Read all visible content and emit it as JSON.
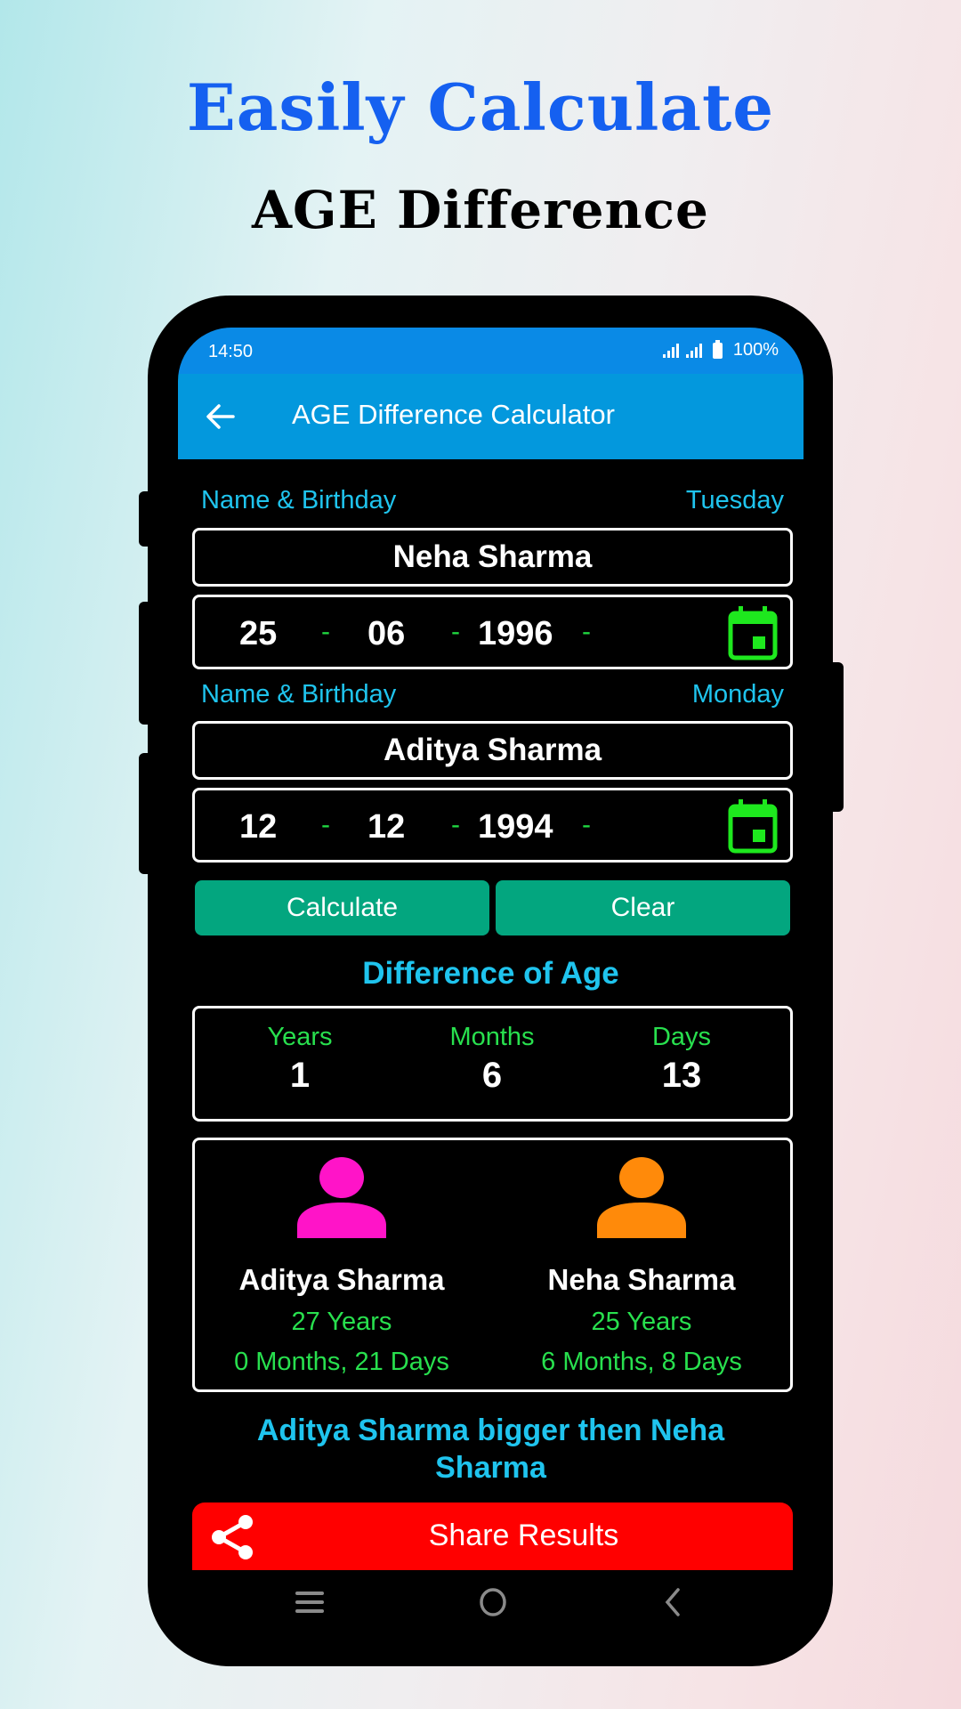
{
  "promo": {
    "line1": "Easily Calculate",
    "line2": "AGE Difference",
    "colors": {
      "line1": "#1560f0",
      "line2": "#000000"
    }
  },
  "status_bar": {
    "time": "14:50",
    "battery": "100%",
    "icons": [
      "signal-icon",
      "signal-icon",
      "battery-icon"
    ]
  },
  "app_bar": {
    "back_icon": "arrow-left-icon",
    "title": "AGE Difference Calculator",
    "color": "#0398dd"
  },
  "person1": {
    "label": "Name & Birthday",
    "weekday": "Tuesday",
    "name": "Neha Sharma",
    "day": "25",
    "month": "06",
    "year": "1996",
    "separator": "-",
    "calendar_icon": "calendar-icon"
  },
  "person2": {
    "label": "Name & Birthday",
    "weekday": "Monday",
    "name": "Aditya Sharma",
    "day": "12",
    "month": "12",
    "year": "1994",
    "separator": "-",
    "calendar_icon": "calendar-icon"
  },
  "buttons": {
    "calculate": "Calculate",
    "clear": "Clear",
    "color": "#03a67f"
  },
  "difference": {
    "title": "Difference of Age",
    "years_label": "Years",
    "years": "1",
    "months_label": "Months",
    "months": "6",
    "days_label": "Days",
    "days": "13"
  },
  "ages": [
    {
      "name": "Aditya Sharma",
      "years": "27 Years",
      "rest": "0 Months, 21 Days",
      "avatar_color": "#ff14c8",
      "icon": "person-icon"
    },
    {
      "name": "Neha Sharma",
      "years": "25 Years",
      "rest": "6 Months, 8 Days",
      "avatar_color": "#ff8a0a",
      "icon": "person-icon"
    }
  ],
  "result": "Aditya Sharma bigger then Neha Sharma",
  "share": {
    "label": "Share Results",
    "icon": "share-icon",
    "color": "#ff0000"
  },
  "nav": {
    "recents": "recents-icon",
    "home": "home-icon",
    "back": "back-icon"
  }
}
